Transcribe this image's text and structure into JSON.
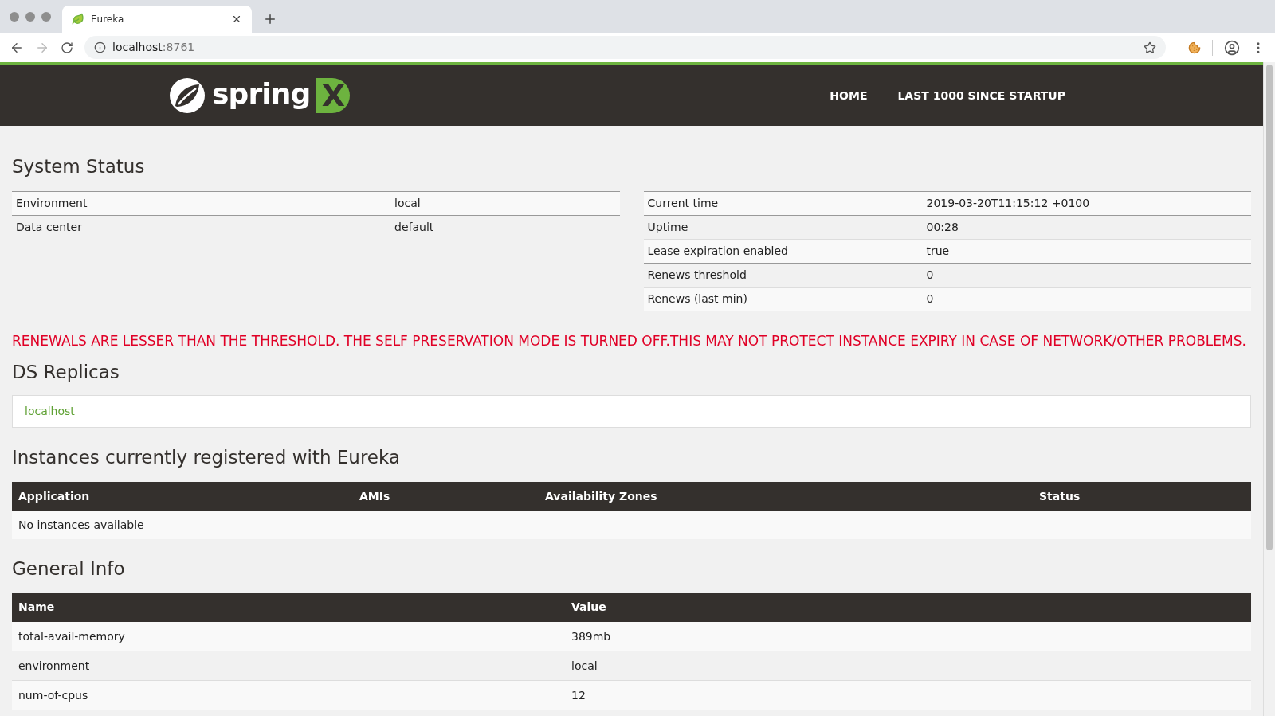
{
  "browser": {
    "tab": {
      "title": "Eureka",
      "selected": true
    },
    "url": {
      "host": "localhost",
      "port": ":8761"
    }
  },
  "header": {
    "logo": {
      "word": "spring",
      "mark": "X"
    },
    "nav": [
      {
        "label": "HOME"
      },
      {
        "label": "LAST 1000 SINCE STARTUP"
      }
    ]
  },
  "system_status": {
    "title": "System Status",
    "left": [
      {
        "name": "Environment",
        "value": "local"
      },
      {
        "name": "Data center",
        "value": "default"
      }
    ],
    "right": [
      {
        "name": "Current time",
        "value": "2019-03-20T11:15:12 +0100"
      },
      {
        "name": "Uptime",
        "value": "00:28"
      },
      {
        "name": "Lease expiration enabled",
        "value": "true"
      },
      {
        "name": "Renews threshold",
        "value": "0"
      },
      {
        "name": "Renews (last min)",
        "value": "0"
      }
    ]
  },
  "warning": "RENEWALS ARE LESSER THAN THE THRESHOLD. THE SELF PRESERVATION MODE IS TURNED OFF.THIS MAY NOT PROTECT INSTANCE EXPIRY IN CASE OF NETWORK/OTHER PROBLEMS.",
  "replicas": {
    "title": "DS Replicas",
    "items": [
      "localhost"
    ]
  },
  "instances": {
    "title": "Instances currently registered with Eureka",
    "columns": [
      "Application",
      "AMIs",
      "Availability Zones",
      "Status"
    ],
    "empty": "No instances available"
  },
  "general_info": {
    "title": "General Info",
    "columns": [
      "Name",
      "Value"
    ],
    "rows": [
      [
        "total-avail-memory",
        "389mb"
      ],
      [
        "environment",
        "local"
      ],
      [
        "num-of-cpus",
        "12"
      ]
    ]
  }
}
